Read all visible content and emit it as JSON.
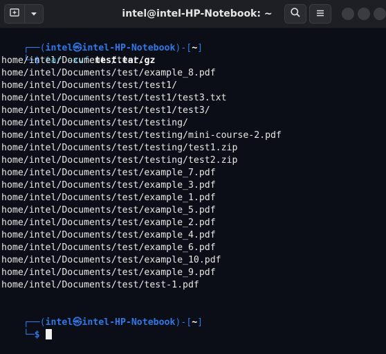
{
  "window": {
    "title": "intel@intel-HP-Notebook: ~"
  },
  "icons": {
    "new_tab": "new-tab-icon",
    "dropdown": "chevron-down-icon",
    "search": "search-icon",
    "menu": "hamburger-menu-icon"
  },
  "prompt": {
    "open": "┌──(",
    "user_host": "intel㉿intel-HP-Notebook",
    "sep": ")-[",
    "dir": "~",
    "close": "]",
    "second_prefix": "└─",
    "dollar": "$"
  },
  "command": {
    "program": "tar",
    "flags": "-xvf",
    "arg": "test.tar.gz"
  },
  "output": [
    "home/intel/Documents/test/",
    "home/intel/Documents/test/example_8.pdf",
    "home/intel/Documents/test/test1/",
    "home/intel/Documents/test/test1/test3.txt",
    "home/intel/Documents/test/test1/test3/",
    "home/intel/Documents/test/testing/",
    "home/intel/Documents/test/testing/mini-course-2.pdf",
    "home/intel/Documents/test/testing/test1.zip",
    "home/intel/Documents/test/testing/test2.zip",
    "home/intel/Documents/test/example_7.pdf",
    "home/intel/Documents/test/example_3.pdf",
    "home/intel/Documents/test/example_1.pdf",
    "home/intel/Documents/test/example_5.pdf",
    "home/intel/Documents/test/example_2.pdf",
    "home/intel/Documents/test/example_4.pdf",
    "home/intel/Documents/test/example_6.pdf",
    "home/intel/Documents/test/example_10.pdf",
    "home/intel/Documents/test/example_9.pdf",
    "home/intel/Documents/test/test-1.pdf"
  ],
  "colors": {
    "background": "#0b0e16",
    "titlebar": "#1d1f24",
    "prompt_blue": "#2f78e8",
    "command_cyan": "#2fa8c8",
    "text": "#e8e8e8"
  }
}
